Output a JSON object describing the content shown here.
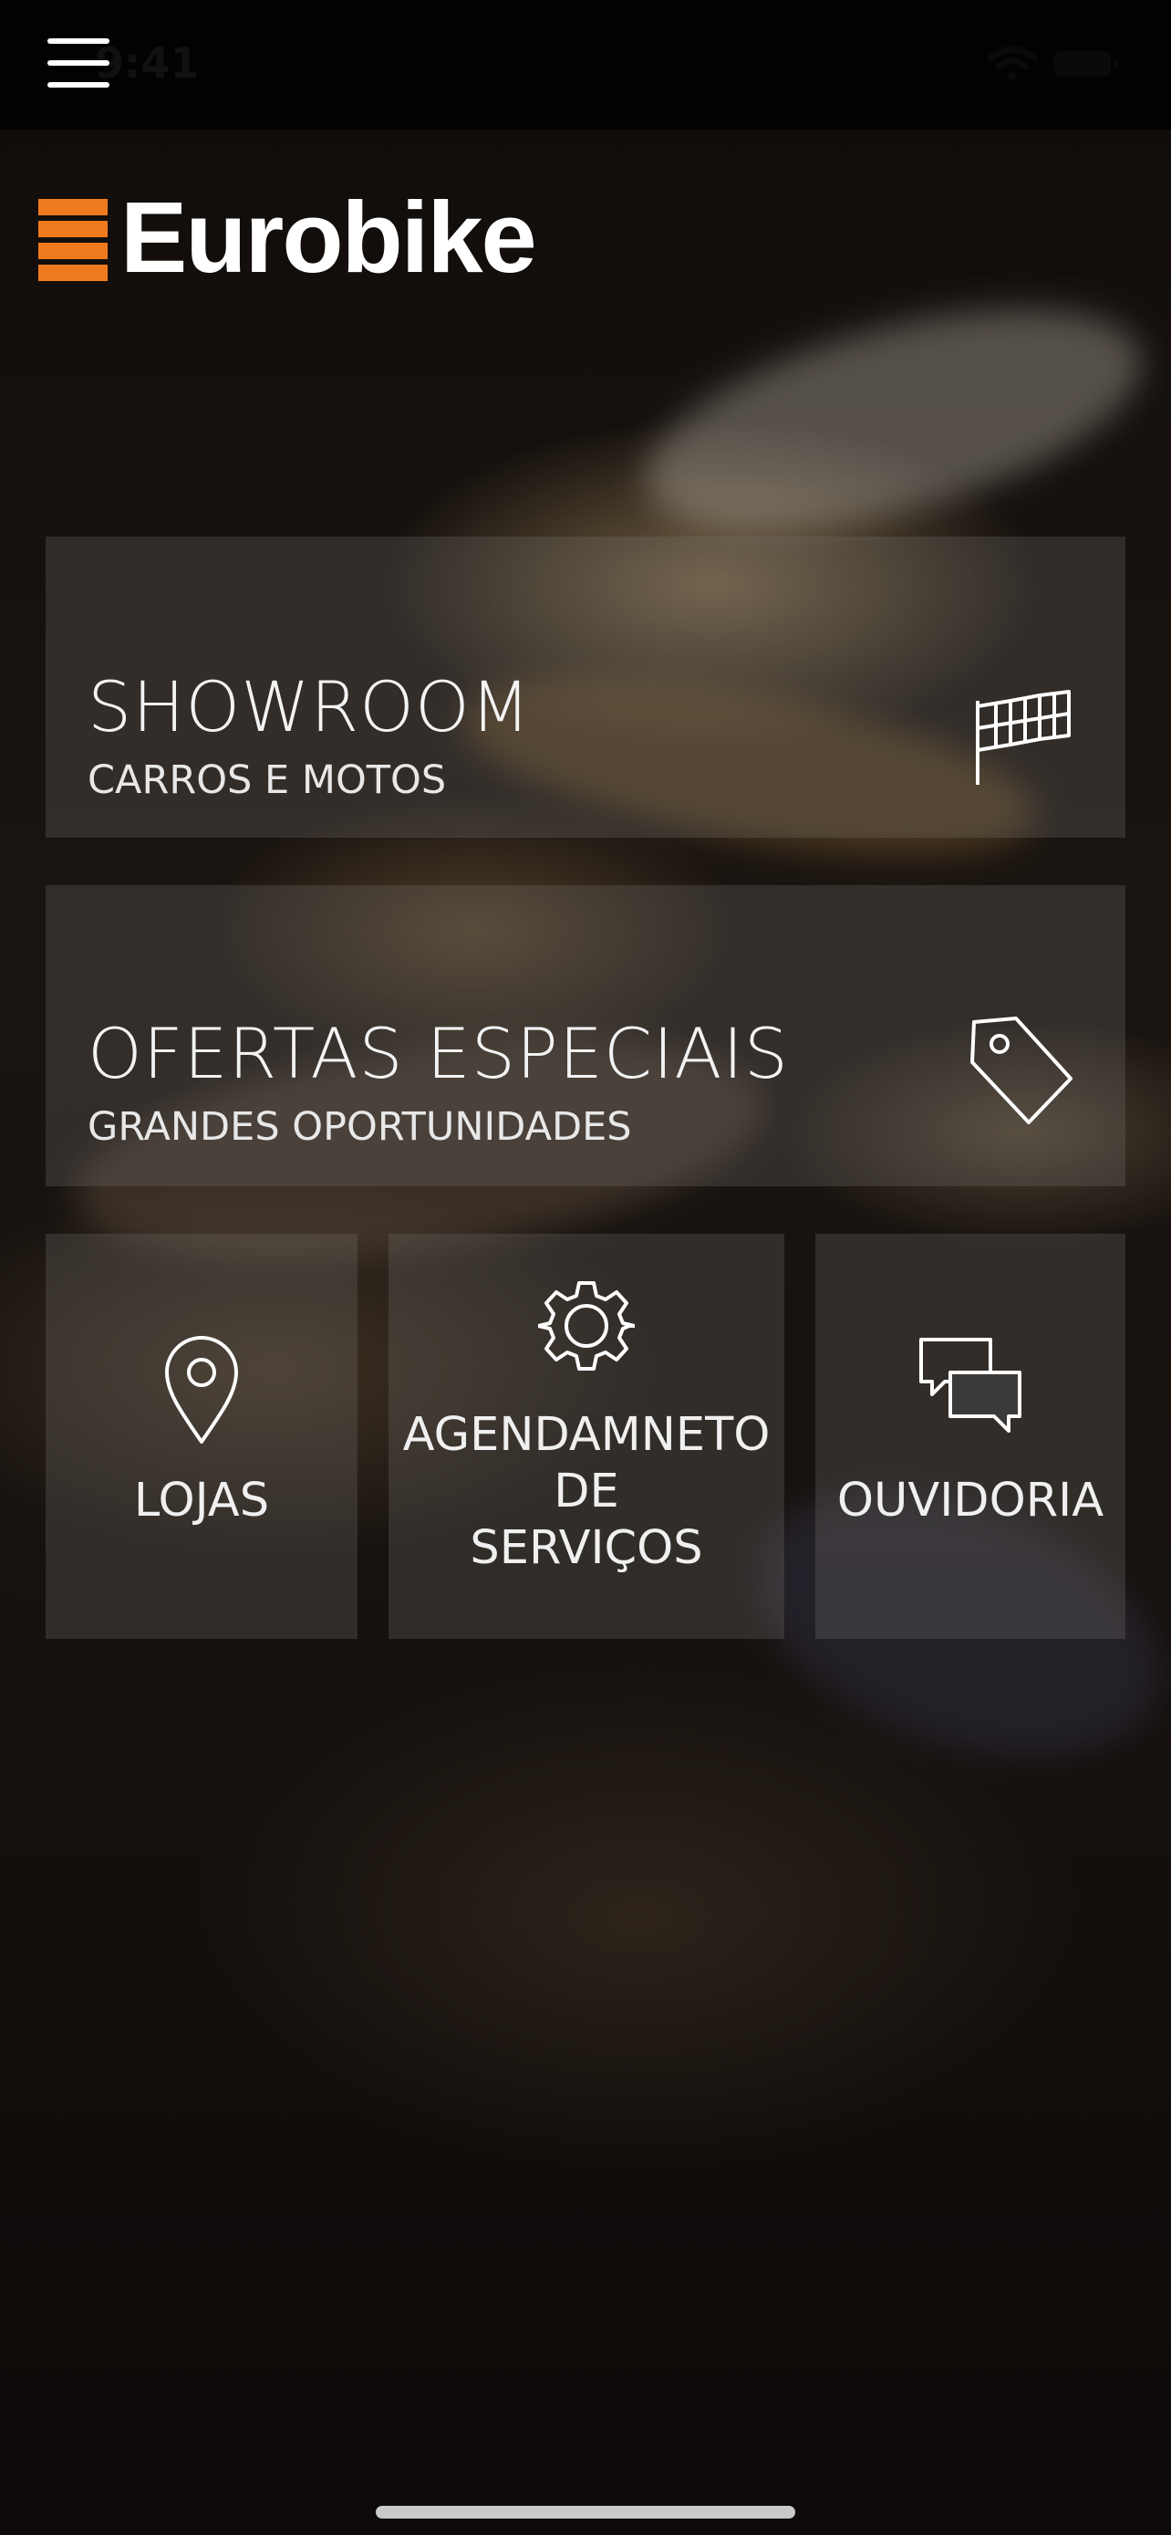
{
  "status_bar": {
    "time": "9:41"
  },
  "header": {
    "brand": "Eurobike",
    "brand_color": "#f07a1e"
  },
  "cards": {
    "showroom": {
      "title": "SHOWROOM",
      "subtitle": "CARROS E MOTOS",
      "icon": "flags-icon"
    },
    "ofertas": {
      "title": "OFERTAS ESPECIAIS",
      "subtitle": "GRANDES OPORTUNIDADES",
      "icon": "price-tag-icon"
    },
    "lojas": {
      "label": "LOJAS",
      "icon": "location-pin-icon"
    },
    "agendamento": {
      "label": "AGENDAMNETO\nDE\nSERVIÇOS",
      "icon": "gear-icon"
    },
    "ouvidoria": {
      "label": "OUVIDORIA",
      "icon": "chat-bubbles-icon"
    }
  }
}
